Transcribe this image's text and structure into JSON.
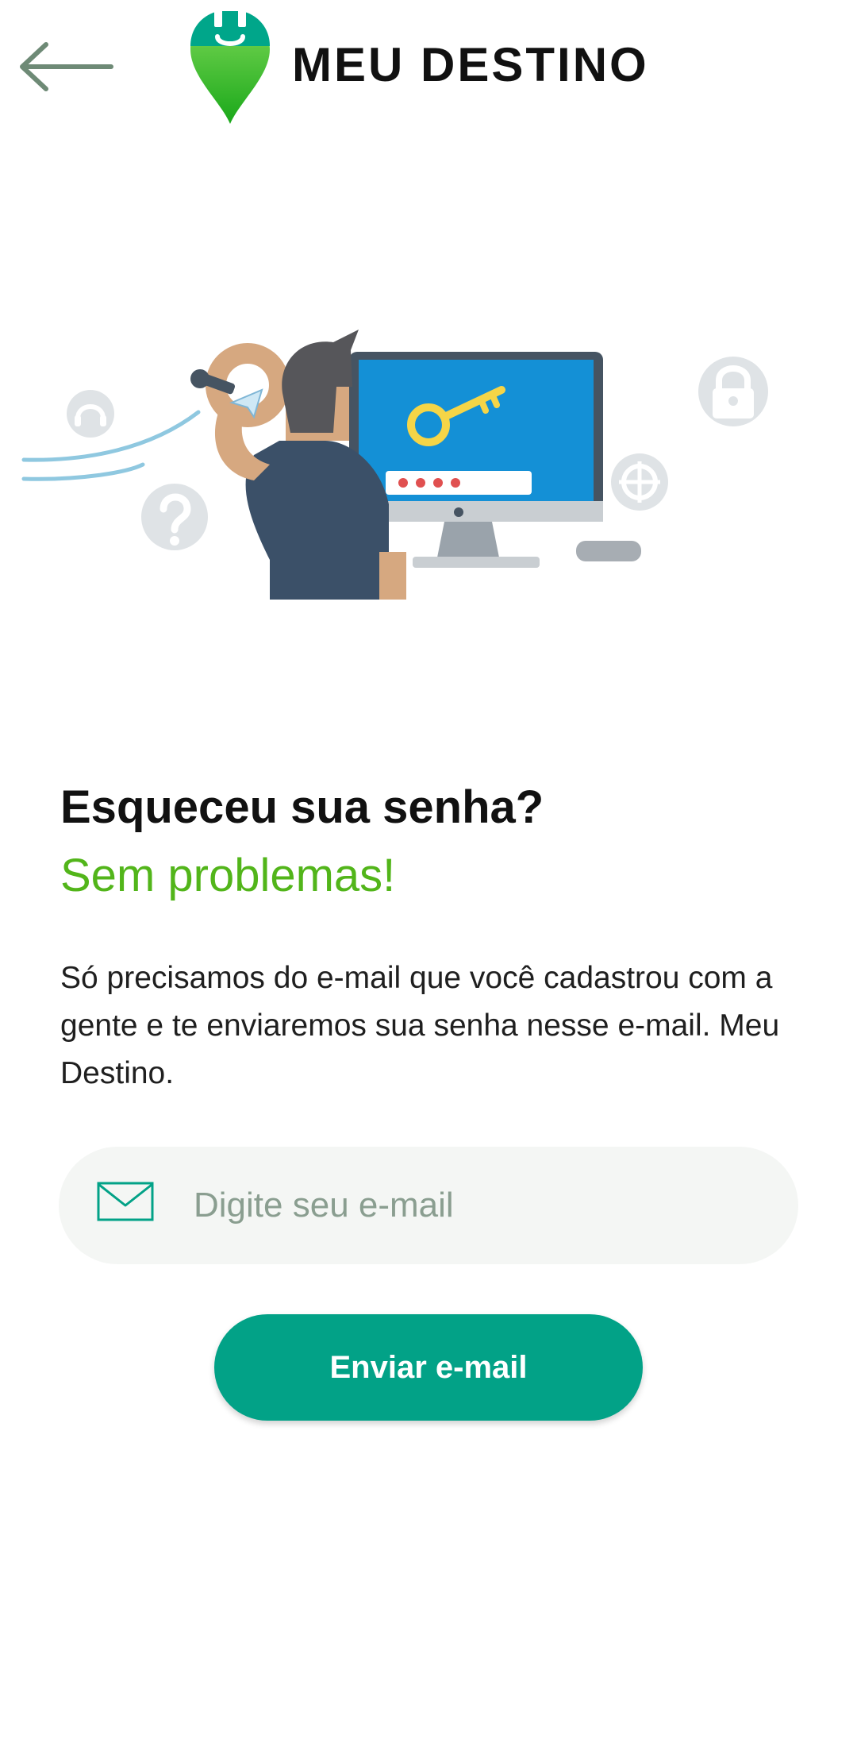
{
  "header": {
    "back_icon": "arrow-left-icon",
    "brand_icon": "location-pin-plug-icon",
    "brand_name": "MEU DESTINO"
  },
  "main": {
    "title": "Esqueceu sua senha?",
    "subtitle": "Sem problemas!",
    "description": "Só precisamos do e-mail que você cadastrou com a gente e te enviaremos sua senha nesse e-mail. Meu Destino.",
    "email_field": {
      "icon": "mail-icon",
      "value": "",
      "placeholder": "Digite seu e-mail"
    },
    "send_button_label": "Enviar e-mail"
  },
  "colors": {
    "accent_teal": "#02a287",
    "accent_green": "#52b51a",
    "field_bg": "#f4f6f4"
  }
}
